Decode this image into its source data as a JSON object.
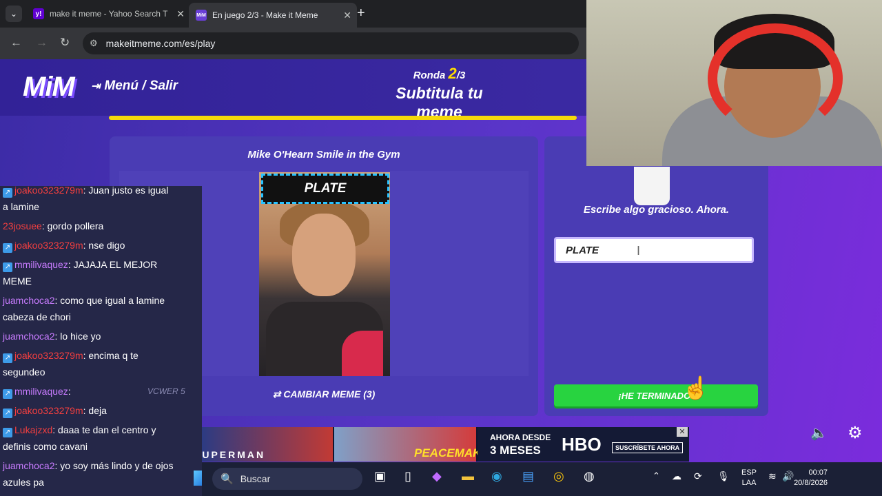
{
  "browser": {
    "tabs": [
      {
        "title": "make it meme - Yahoo Search T",
        "favicon": "yahoo-icon",
        "active": false
      },
      {
        "title": "En juego 2/3 - Make it Meme",
        "favicon": "mim-icon",
        "active": true
      }
    ],
    "url": "makeitmeme.com/es/play"
  },
  "game": {
    "logo": "MiM",
    "menu_label": "Menú / Salir",
    "round_label": "Ronda",
    "round_current": "2",
    "round_total": "/3",
    "phase_title": "Subtitula tu meme",
    "progress_fraction": 0.97,
    "meme_name": "Mike O'Hearn Smile in the Gym",
    "meme_caption": "PLATE",
    "change_meme_label": "CAMBIAR MEME (3)",
    "prompt": "Escribe algo gracioso. Ahora.",
    "input_value": "PLATE",
    "done_label": "¡HE TERMINADO!"
  },
  "ad": {
    "superman": "SUPERMAN",
    "peacemaker": "PEACEMAKER",
    "hbo_line1": "AHORA DESDE",
    "hbo_line2": "3 MESES",
    "hbo_logo": "HBO",
    "hbo_cta": "SUSCRÍBETE AHORA"
  },
  "chat": [
    {
      "user": "joakoo323279m",
      "text": ": Juan justo es igual",
      "cont": "a lamine",
      "color": "red",
      "badge": true
    },
    {
      "user": "23josuee",
      "text": ": gordo pollera",
      "color": "red",
      "badge": false
    },
    {
      "user": "joakoo323279m",
      "text": ": nse digo",
      "color": "red",
      "badge": true
    },
    {
      "user": "mmilivaquez",
      "text": ": JAJAJA EL MEJOR",
      "cont": "MEME",
      "color": "purple",
      "badge": true
    },
    {
      "user": "juamchoca2",
      "text": ": como que igual a lamine",
      "cont": "cabeza de chori",
      "color": "purple",
      "badge": false
    },
    {
      "user": "juamchoca2",
      "text": ": lo hice yo",
      "color": "purple",
      "badge": false
    },
    {
      "user": "joakoo323279m",
      "text": ": encima q te",
      "cont": "segundeo",
      "color": "red",
      "badge": true
    },
    {
      "user": "mmilivaquez",
      "text": ":",
      "color": "purple",
      "badge": true
    },
    {
      "user": "joakoo323279m",
      "text": ": deja",
      "color": "red",
      "badge": true
    },
    {
      "user": "Lukajzxd",
      "text": ": daaa te dan el centro y",
      "cont": "definis como cavani",
      "color": "red",
      "badge": true
    },
    {
      "user": "juamchoca2",
      "text": ": yo soy más lindo y de ojos",
      "cont": "azules pa",
      "color": "purple",
      "badge": false
    }
  ],
  "chat_overlay_text": "VCWER 5",
  "taskbar": {
    "search_placeholder": "Buscar",
    "lang_line1": "ESP",
    "lang_line2": "LAA",
    "time": "00:07",
    "date": "20/8/2026"
  },
  "colors": {
    "accent_yellow": "#f5d90a",
    "done_green": "#28d340",
    "page_purple": "#5a35c9"
  }
}
